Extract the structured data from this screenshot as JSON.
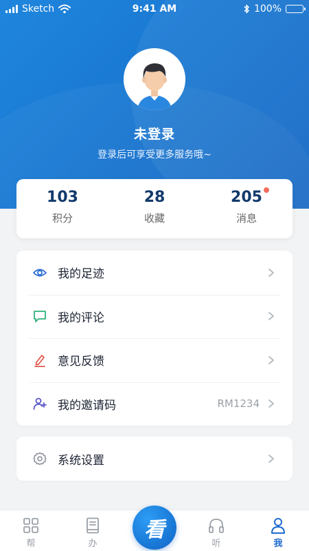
{
  "status_bar": {
    "carrier": "Sketch",
    "time": "9:41 AM",
    "battery": "100%"
  },
  "profile": {
    "name": "未登录",
    "subtitle": "登录后可享受更多服务哦~"
  },
  "stats": [
    {
      "value": "103",
      "label": "积分"
    },
    {
      "value": "28",
      "label": "收藏"
    },
    {
      "value": "205",
      "label": "消息",
      "has_badge": true
    }
  ],
  "menu": [
    {
      "label": "我的足迹",
      "icon": "eye-icon",
      "icon_color": "#2f6fd6"
    },
    {
      "label": "我的评论",
      "icon": "comment-icon",
      "icon_color": "#2fb27a"
    },
    {
      "label": "意见反馈",
      "icon": "pencil-icon",
      "icon_color": "#e2574c"
    },
    {
      "label": "我的邀请码",
      "icon": "add-user-icon",
      "icon_color": "#5c56c9",
      "extra": "RM1234"
    }
  ],
  "settings": {
    "label": "系统设置",
    "icon": "gear-icon"
  },
  "tabs": [
    {
      "label": "帮",
      "icon": "grid-icon"
    },
    {
      "label": "办",
      "icon": "book-icon"
    },
    {
      "label": "看",
      "icon": "center-logo-icon"
    },
    {
      "label": "听",
      "icon": "headphones-icon"
    },
    {
      "label": "我",
      "icon": "user-icon",
      "active": true
    }
  ],
  "colors": {
    "header_blue": "#1a78d2",
    "accent": "#1e6bd0",
    "badge_red": "#f36c5e",
    "stat_number": "#123a6b"
  }
}
